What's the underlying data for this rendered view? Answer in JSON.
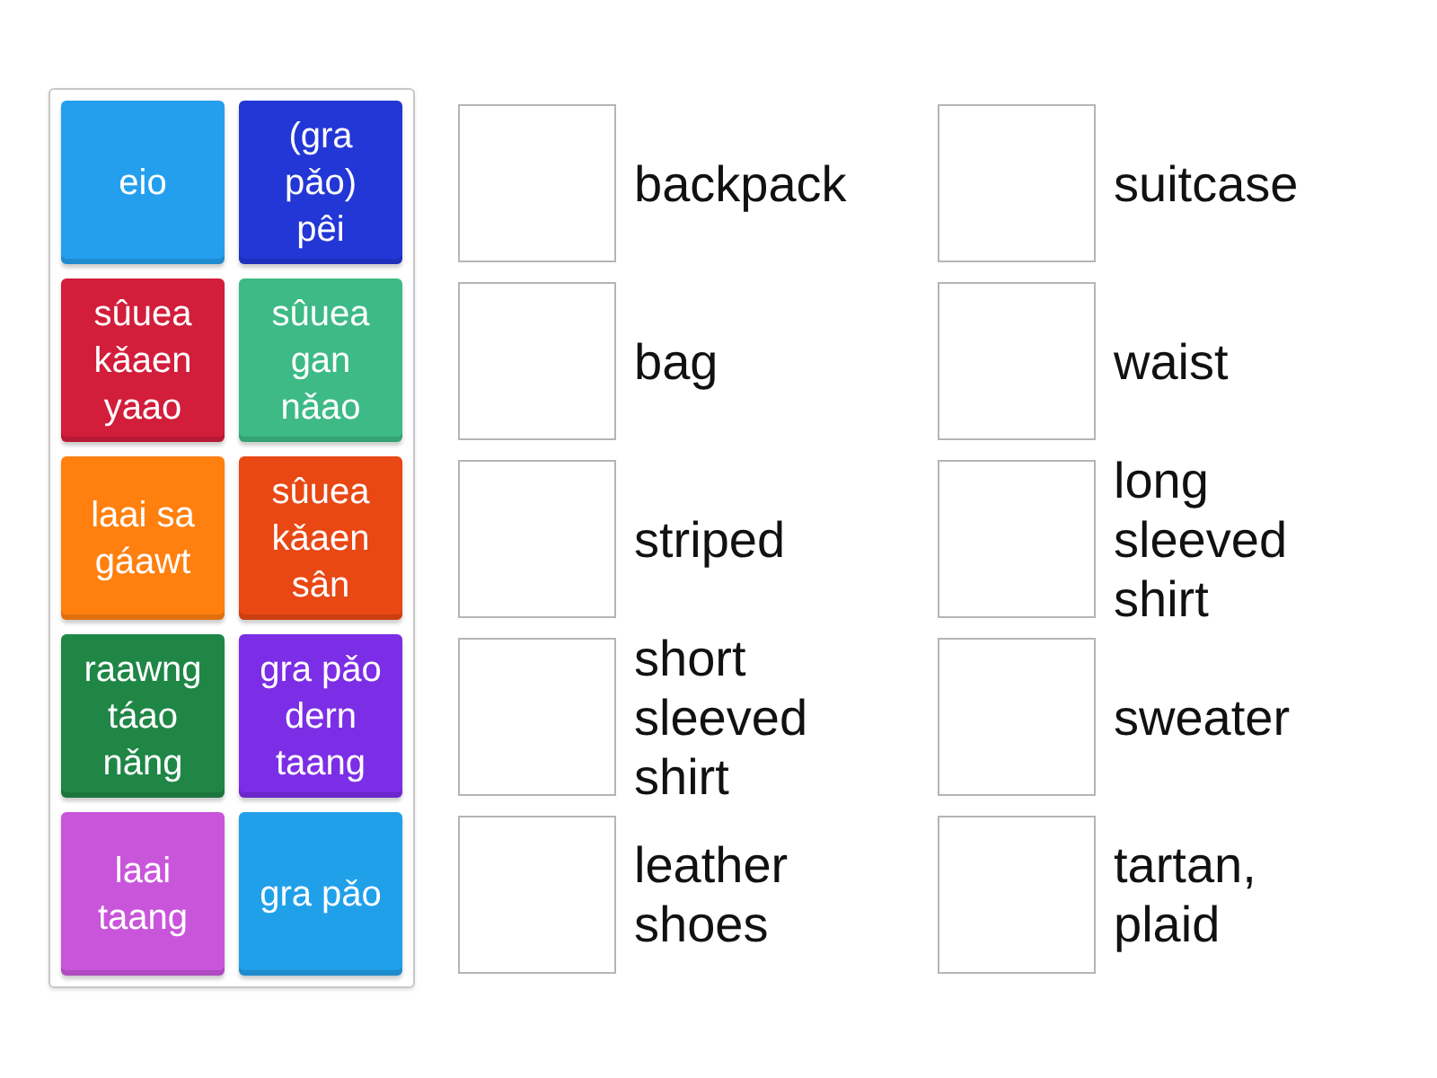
{
  "tiles": [
    {
      "text": "eio",
      "color": "#249fee"
    },
    {
      "text": "sûuea kǎaen yaao",
      "color": "#d21d3b"
    },
    {
      "text": "laai sa gáawt",
      "color": "#ff800f"
    },
    {
      "text": "raawng táao nǎng",
      "color": "#1f8646"
    },
    {
      "text": "laai taang",
      "color": "#c955db"
    },
    {
      "text": "(gra pǎo) pêi",
      "color": "#2337d6"
    },
    {
      "text": "sûuea gan nǎao",
      "color": "#3dba85"
    },
    {
      "text": "sûuea kǎaen sân",
      "color": "#e94714"
    },
    {
      "text": "gra pǎo dern taang",
      "color": "#7c2ee6"
    },
    {
      "text": "gra pǎo",
      "color": "#21a0ea"
    }
  ],
  "targets": [
    {
      "label": "backpack"
    },
    {
      "label": "bag"
    },
    {
      "label": "striped"
    },
    {
      "label": "short sleeved shirt"
    },
    {
      "label": "leather shoes"
    },
    {
      "label": "suitcase"
    },
    {
      "label": "waist"
    },
    {
      "label": "long sleeved shirt"
    },
    {
      "label": "sweater"
    },
    {
      "label": "tartan, plaid"
    }
  ]
}
